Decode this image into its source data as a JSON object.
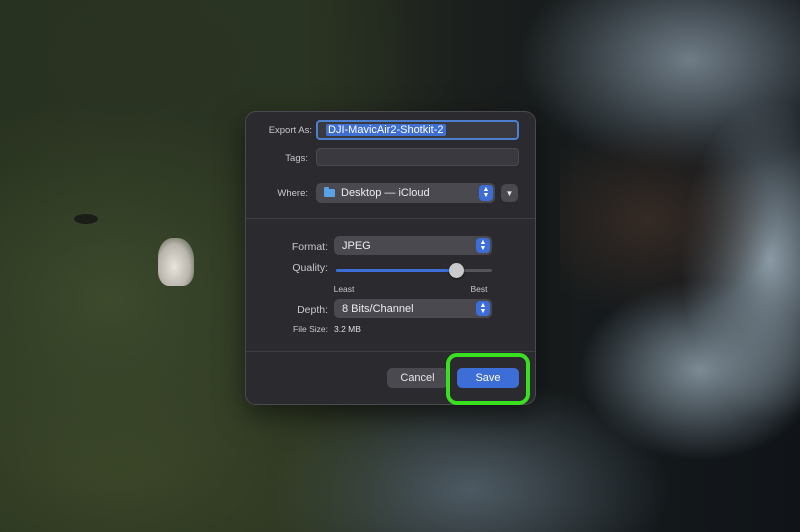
{
  "dialog": {
    "export_as_label": "Export As:",
    "filename": "DJI-MavicAir2-Shotkit-2",
    "tags_label": "Tags:",
    "tags_value": "",
    "where_label": "Where:",
    "where_value": "Desktop — iCloud",
    "format_label": "Format:",
    "format_value": "JPEG",
    "quality_label": "Quality:",
    "quality_level": 0.8,
    "quality_min_label": "Least",
    "quality_max_label": "Best",
    "depth_label": "Depth:",
    "depth_value": "8 Bits/Channel",
    "filesize_label": "File Size:",
    "filesize_value": "3.2 MB",
    "cancel_label": "Cancel",
    "save_label": "Save"
  },
  "icons": {
    "folder": "folder-icon",
    "chevron_updown": "chevron-updown-icon",
    "expand": "chevron-down-icon"
  },
  "colors": {
    "accent": "#3d6dd6",
    "highlight_ring": "#39e01f",
    "dialog_bg": "#2b2a2f"
  }
}
